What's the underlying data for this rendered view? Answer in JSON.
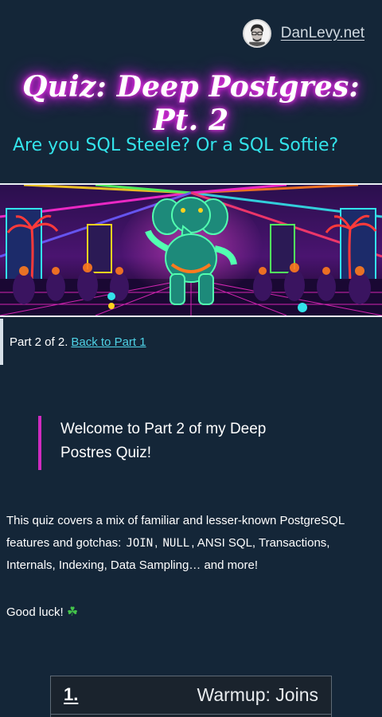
{
  "header": {
    "site_name": "DanLevy.net"
  },
  "page": {
    "title": "Quiz: Deep Postgres: Pt. 2",
    "subtitle": "Are you SQL Steele? Or a SQL Softie?"
  },
  "part_notice": {
    "text": "Part 2 of 2.",
    "link_label": "Back to Part 1"
  },
  "welcome": {
    "text": "Welcome to Part 2 of my Deep Postres Quiz!"
  },
  "intro": {
    "before": "This quiz covers a mix of familiar and lesser-known PostgreSQL features and gotchas: ",
    "code_join": "JOIN",
    "sep": ", ",
    "code_null": "NULL",
    "after": ", ANSI SQL, Transactions, Internals, Indexing, Data Sampling… and more!",
    "good_luck": "Good luck!",
    "clover_icon": "☘"
  },
  "question": {
    "number": "1.",
    "title": "Warmup: Joins"
  },
  "colors": {
    "background": "#142638",
    "accent_cyan": "#33e3ea",
    "accent_pink": "#d02bc0",
    "link": "#4fd2e6"
  }
}
